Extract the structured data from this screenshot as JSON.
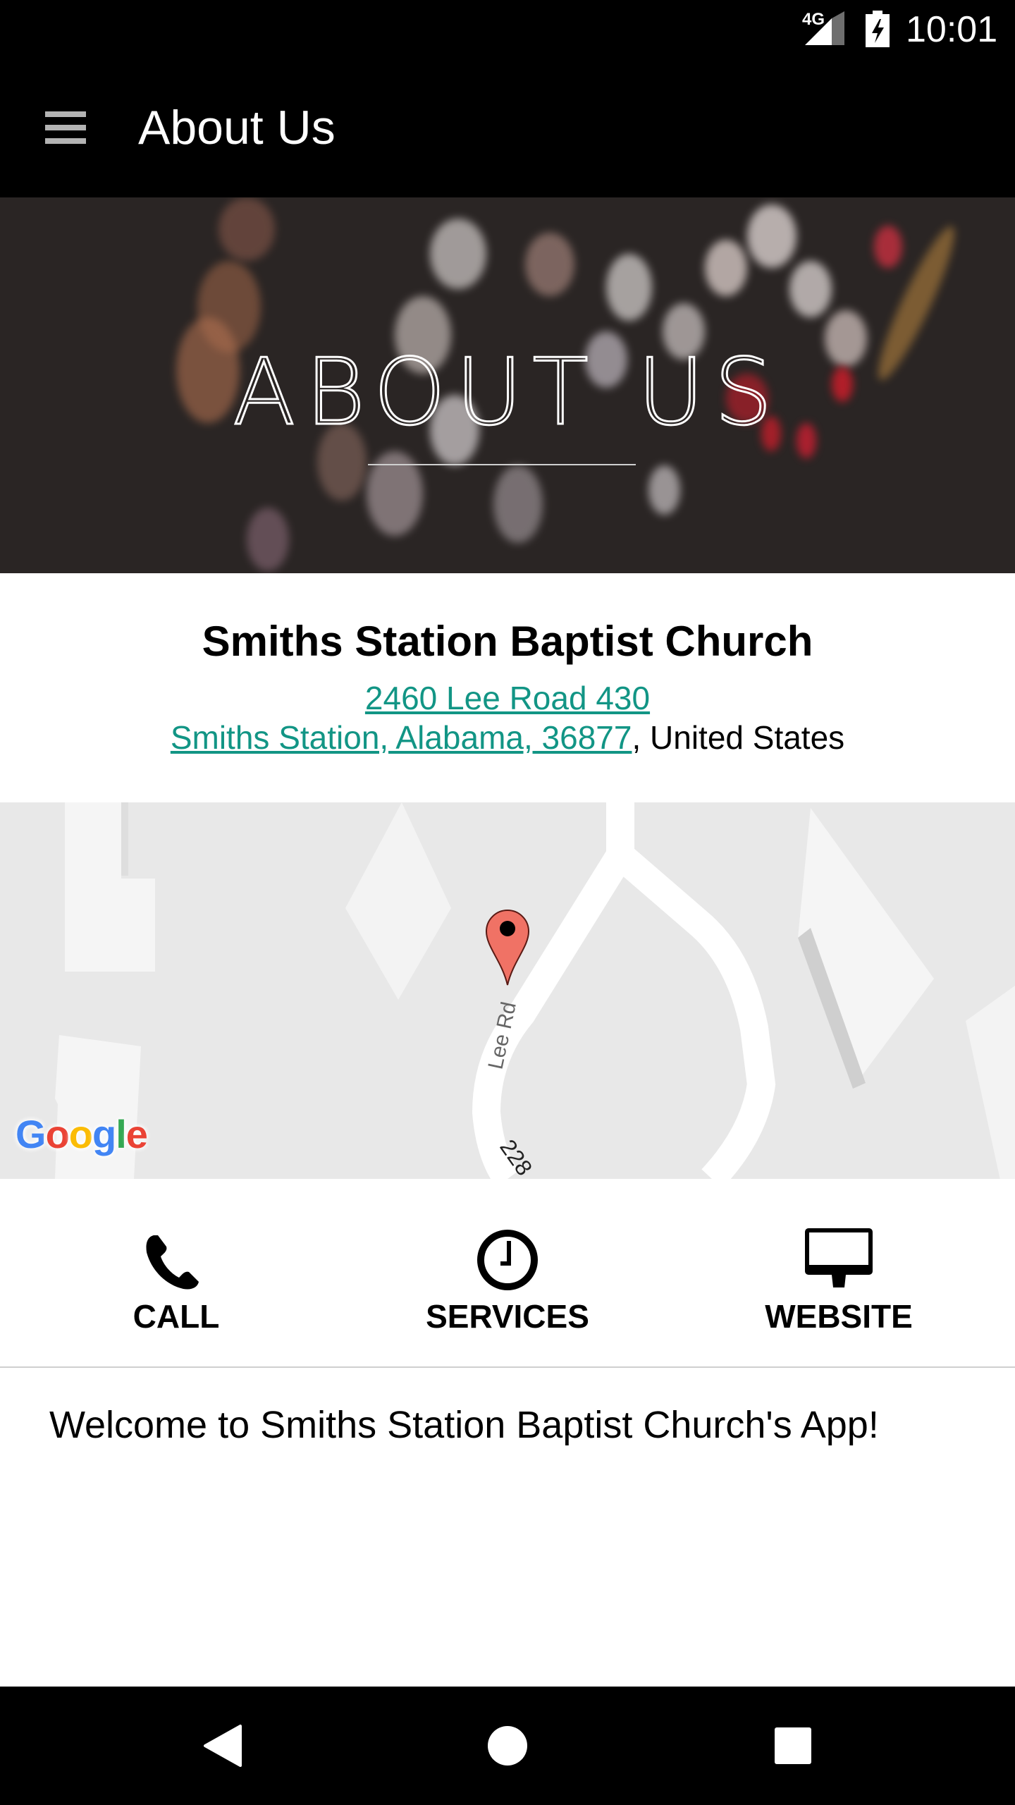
{
  "status_bar": {
    "network": "4G",
    "time": "10:01",
    "icons": [
      "signal-icon",
      "battery-charging-icon"
    ]
  },
  "app_bar": {
    "menu_icon": "hamburger-menu-icon",
    "title": "About Us"
  },
  "banner": {
    "title": "ABOUT US"
  },
  "church": {
    "name": "Smiths Station Baptist Church",
    "address_line1": "2460 Lee Road 430",
    "address_line2_link": "Smiths Station, Alabama, 36877",
    "address_line2_suffix": ", United States",
    "link_color": "#129585"
  },
  "map": {
    "road_label": "Lee Rd",
    "route_label": "228",
    "marker_color": "#f07265",
    "logo": {
      "letters": [
        {
          "char": "G",
          "color": "#4285f4"
        },
        {
          "char": "o",
          "color": "#ea4335"
        },
        {
          "char": "o",
          "color": "#fbbc05"
        },
        {
          "char": "g",
          "color": "#4285f4"
        },
        {
          "char": "l",
          "color": "#34a853"
        },
        {
          "char": "e",
          "color": "#ea4335"
        }
      ]
    }
  },
  "actions": [
    {
      "label": "CALL",
      "icon": "phone-icon"
    },
    {
      "label": "SERVICES",
      "icon": "clock-icon"
    },
    {
      "label": "WEBSITE",
      "icon": "desktop-monitor-icon"
    }
  ],
  "welcome_text": "Welcome to Smiths Station Baptist Church's App!",
  "nav_bar": {
    "buttons": [
      "back-icon",
      "home-icon",
      "recents-icon"
    ]
  }
}
